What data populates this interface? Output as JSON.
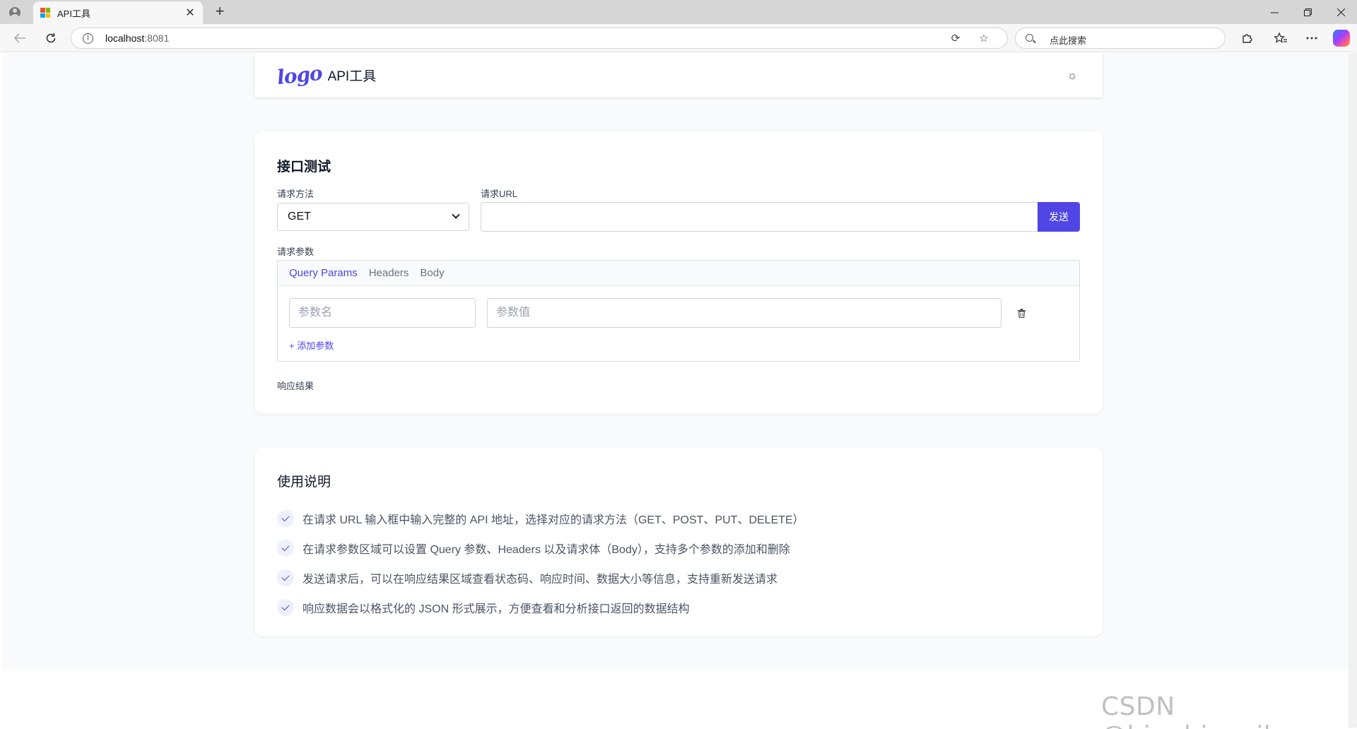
{
  "browser": {
    "tab_title": "API工具",
    "url_host": "localhost",
    "url_port": ":8081",
    "search_placeholder": "点此搜索",
    "close_glyph": "✕",
    "new_tab_glyph": "+"
  },
  "header": {
    "logo_text": "logo",
    "title": "API工具",
    "theme_glyph": "☼"
  },
  "api_test": {
    "heading": "接口测试",
    "method_label": "请求方法",
    "method_value": "GET",
    "url_label": "请求URL",
    "url_value": "",
    "send_label": "发送",
    "params_label": "请求参数",
    "tabs": [
      "Query Params",
      "Headers",
      "Body"
    ],
    "param_name_placeholder": "参数名",
    "param_value_placeholder": "参数值",
    "add_param_label": "+ 添加参数",
    "response_label": "响应结果"
  },
  "help": {
    "heading": "使用说明",
    "items": [
      "在请求 URL 输入框中输入完整的 API 地址，选择对应的请求方法（GET、POST、PUT、DELETE）",
      "在请求参数区域可以设置 Query 参数、Headers 以及请求体（Body），支持多个参数的添加和删除",
      "发送请求后，可以在响应结果区域查看状态码、响应时间、数据大小等信息，支持重新发送请求",
      "响应数据会以格式化的 JSON 形式展示，方便查看和分析接口返回的数据结构"
    ]
  },
  "watermark": "CSDN @bingbingyihao",
  "colors": {
    "accent": "#4f46e5",
    "page_bg": "#f9fafb"
  }
}
